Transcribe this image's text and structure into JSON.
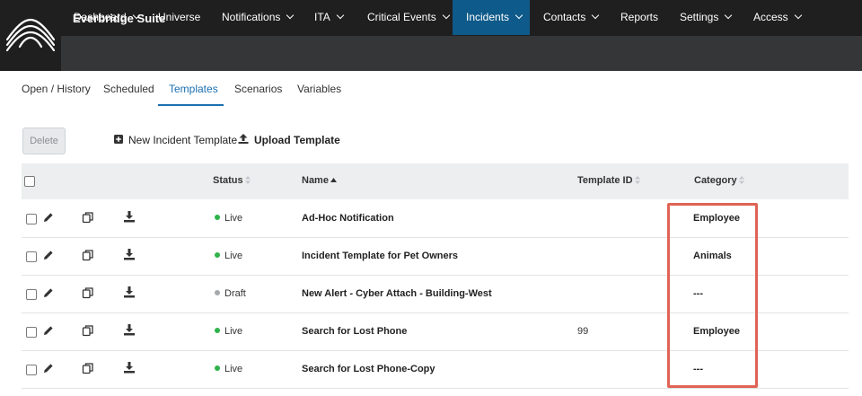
{
  "app": {
    "title": "Everbridge Suite"
  },
  "nav": {
    "items": [
      {
        "label": "Dashboard",
        "dropdown": true,
        "active": false
      },
      {
        "label": "Universe",
        "dropdown": false,
        "active": false
      },
      {
        "label": "Notifications",
        "dropdown": true,
        "active": false
      },
      {
        "label": "ITA",
        "dropdown": true,
        "active": false
      },
      {
        "label": "Critical Events",
        "dropdown": true,
        "active": false
      },
      {
        "label": "Incidents",
        "dropdown": true,
        "active": true
      },
      {
        "label": "Contacts",
        "dropdown": true,
        "active": false
      },
      {
        "label": "Reports",
        "dropdown": false,
        "active": false
      },
      {
        "label": "Settings",
        "dropdown": true,
        "active": false
      },
      {
        "label": "Access",
        "dropdown": true,
        "active": false
      }
    ]
  },
  "subtabs": [
    {
      "label": "Open / History",
      "active": false
    },
    {
      "label": "Scheduled",
      "active": false
    },
    {
      "label": "Templates",
      "active": true
    },
    {
      "label": "Scenarios",
      "active": false
    },
    {
      "label": "Variables",
      "active": false
    }
  ],
  "toolbar": {
    "delete_label": "Delete",
    "new_label": "New Incident Template",
    "upload_label": "Upload Template"
  },
  "table": {
    "headers": {
      "status": "Status",
      "name": "Name",
      "template_id": "Template ID",
      "category": "Category"
    },
    "rows": [
      {
        "status": "Live",
        "status_color": "#2db34a",
        "name": "Ad-Hoc Notification",
        "template_id": "",
        "category": "Employee"
      },
      {
        "status": "Live",
        "status_color": "#2db34a",
        "name": "Incident Template for Pet Owners",
        "template_id": "",
        "category": "Animals"
      },
      {
        "status": "Draft",
        "status_color": "#a5a9ad",
        "name": "New Alert - Cyber Attach - Building-West",
        "template_id": "",
        "category": "---"
      },
      {
        "status": "Live",
        "status_color": "#2db34a",
        "name": "Search for Lost Phone",
        "template_id": "99",
        "category": "Employee"
      },
      {
        "status": "Live",
        "status_color": "#2db34a",
        "name": "Search for Lost Phone-Copy",
        "template_id": "",
        "category": "---"
      }
    ]
  },
  "colors": {
    "highlight": "#e06355",
    "accent": "#1a6fb0",
    "nav_active": "#0e5a8a",
    "topbar": "#1f1f1f",
    "navbar": "#343638"
  }
}
